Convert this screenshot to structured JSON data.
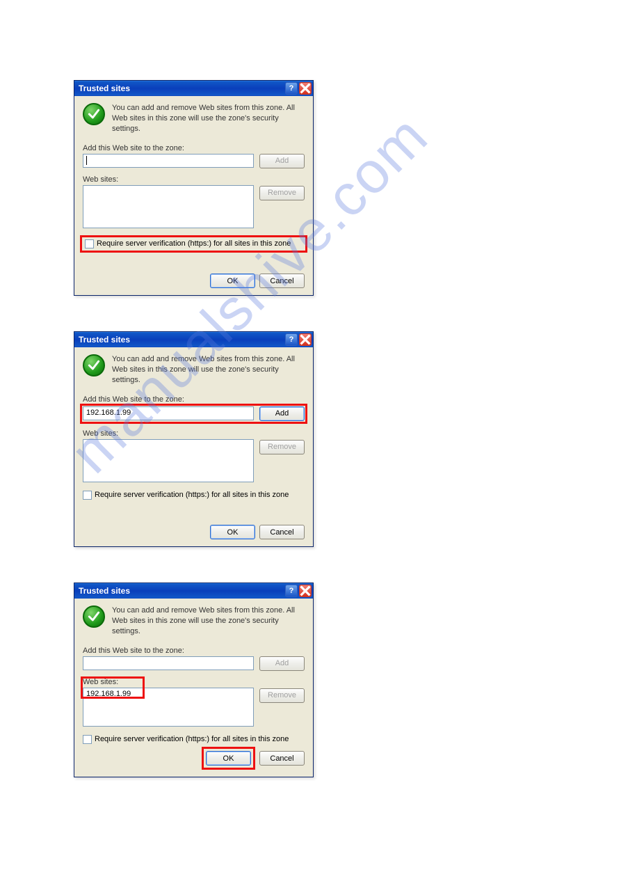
{
  "watermark": "manualshive.com",
  "dialog1": {
    "title": "Trusted sites",
    "info": "You can add and remove Web sites from this zone. All Web sites in this zone will use the zone's security settings.",
    "add_label": "Add this Web site to the zone:",
    "add_value": "",
    "add_btn": "Add",
    "sites_label": "Web sites:",
    "sites": [],
    "remove_btn": "Remove",
    "require_label": "Require server verification (https:) for all sites in this zone",
    "ok": "OK",
    "cancel": "Cancel"
  },
  "dialog2": {
    "title": "Trusted sites",
    "info": "You can add and remove Web sites from this zone. All Web sites in this zone will use the zone's security settings.",
    "add_label": "Add this Web site to the zone:",
    "add_value": "192.168.1.99",
    "add_btn": "Add",
    "sites_label": "Web sites:",
    "sites": [],
    "remove_btn": "Remove",
    "require_label": "Require server verification (https:) for all sites in this zone",
    "ok": "OK",
    "cancel": "Cancel"
  },
  "dialog3": {
    "title": "Trusted sites",
    "info": "You can add and remove Web sites from this zone. All Web sites in this zone will use the zone's security settings.",
    "add_label": "Add this Web site to the zone:",
    "add_value": "",
    "add_btn": "Add",
    "sites_label": "Web sites:",
    "sites": [
      "192.168.1.99"
    ],
    "remove_btn": "Remove",
    "require_label": "Require server verification (https:) for all sites in this zone",
    "ok": "OK",
    "cancel": "Cancel"
  }
}
